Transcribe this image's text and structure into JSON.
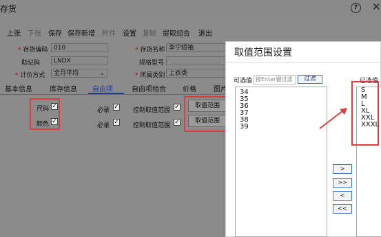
{
  "window": {
    "title": "存货",
    "help_icon": "help-icon",
    "close_icon": "close-icon"
  },
  "toolbar": {
    "items": [
      {
        "label": "上张",
        "disabled": false
      },
      {
        "label": "下张",
        "disabled": true
      },
      {
        "label": "保存",
        "disabled": false
      },
      {
        "label": "保存新增",
        "disabled": false
      },
      {
        "label": "附件",
        "disabled": true
      },
      {
        "label": "设置",
        "disabled": false
      },
      {
        "label": "复制",
        "disabled": true
      },
      {
        "label": "提取组合",
        "disabled": false
      },
      {
        "label": "退出",
        "disabled": false
      }
    ]
  },
  "form": {
    "code_label": "存货编码",
    "code_value": "010",
    "name_label": "存货名称",
    "name_value": "李宁短袖",
    "mnemonic_label": "助记码",
    "mnemonic_value": "LNDX",
    "spec_label": "规格型号",
    "spec_value": "",
    "valuation_label": "计价方式",
    "valuation_value": "全月平均",
    "category_label": "所属类别",
    "category_value": "上衣类"
  },
  "tabs": [
    "基本信息",
    "库存信息",
    "自由项",
    "自由项组合",
    "价格",
    "图片"
  ],
  "active_tab": "自由项",
  "free_items": {
    "rows": [
      {
        "name": "尺码",
        "required_label": "必录",
        "control_label": "控制取值范围",
        "range_btn": "取值范围"
      },
      {
        "name": "颜色",
        "required_label": "必录",
        "control_label": "控制取值范围",
        "range_btn": "取值范围"
      }
    ]
  },
  "dialog": {
    "title": "取值范围设置",
    "available_label": "可选值",
    "filter_placeholder": "按Enter键过滤",
    "filter_button": "过滤",
    "available_values": [
      "34",
      "35",
      "36",
      "37",
      "38",
      "39"
    ],
    "selected_label": "已选值",
    "selected_values": [
      "S",
      "M",
      "L",
      "XL",
      "XXL",
      "XXXL"
    ],
    "move_buttons": [
      ">",
      ">>",
      "<",
      "<<"
    ]
  },
  "colors": {
    "highlight": "#e23b3b",
    "accent": "#1d3d8a"
  }
}
